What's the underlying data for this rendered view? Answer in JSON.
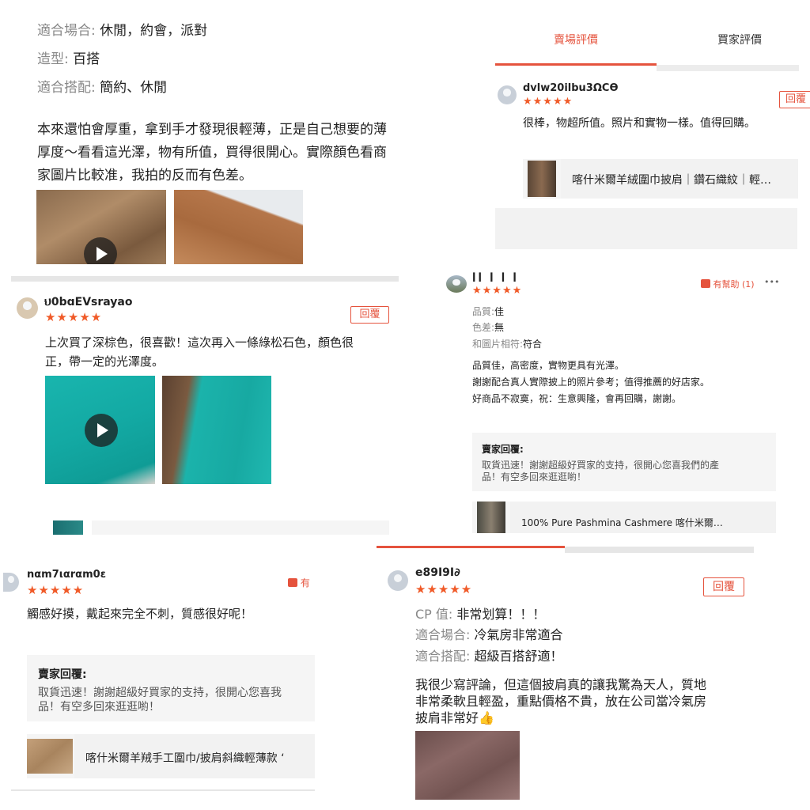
{
  "panel1": {
    "attr_occasion_label": "適合場合:",
    "attr_occasion_value": "休閒，約會，派對",
    "attr_style_label": "造型:",
    "attr_style_value": "百搭",
    "attr_match_label": "適合搭配:",
    "attr_match_value": "簡約、休閒",
    "review_line1": "本來還怕會厚重，拿到手才發現很輕薄，正是自己想要的薄",
    "review_line2": "厚度～看看這光澤，物有所值，買得很開心。實際顏色看商",
    "review_line3": "家圖片比較准，我拍的反而有色差。"
  },
  "panel2": {
    "tab_store": "賣場評價",
    "tab_buyer": "買家評價",
    "username": "dvlw20ilbu3ΩCϴ",
    "stars": "★★★★★",
    "reply": "回覆",
    "review": "很棒，物超所值。照片和實物一樣。值得回購。",
    "product": "喀什米爾羊絨圍巾披肩｜鑽石織紋｜輕…"
  },
  "panel3": {
    "username": "ህ0bɑEVsrayao",
    "stars": "★★★★★",
    "reply": "回覆",
    "review_line1": "上次買了深棕色，很喜歡！這次再入一條綠松石色，顏色很",
    "review_line2": "正，帶一定的光澤度。"
  },
  "panel4": {
    "username": "ꟾꟾ ꟾ ꟾ ꟾ",
    "stars": "★★★★★",
    "helpful": "有幫助 (1)",
    "more": "•••",
    "quality_label": "品質:",
    "quality_value": "佳",
    "color_label": "色差:",
    "color_value": "無",
    "match_label": "和圖片相符:",
    "match_value": "符合",
    "review_line1": "品質佳，高密度，實物更具有光澤。",
    "review_line2": "謝謝配合真人實際披上的照片參考；值得推薦的好店家。",
    "review_line3": "好商品不寂寞，祝：生意興隆，會再回購，謝謝。",
    "seller_title": "賣家回覆:",
    "seller_line1": "取貨迅速！謝謝超級好買家的支持，很開心您喜我們的產",
    "seller_line2": "品！有空多回來逛逛喲！",
    "product": "100%  Pure Pashmina  Cashmere  喀什米爾…"
  },
  "panel5": {
    "username": "nαm7ιαrαm0ε​",
    "stars": "★★★★★",
    "helpful": "有",
    "review": "觸感好摸，戴起來完全不刺，質感很好呢！",
    "seller_title": "賣家回覆:",
    "seller_line1": "取貨迅速！謝謝超級好買家的支持，很開心您喜我",
    "seller_line2": "品！有空多回來逛逛喲！",
    "product": "喀什米爾羊羢手工圍巾/披肩斜織輕薄款 ‘"
  },
  "panel6": {
    "username": "e89I9I∂",
    "stars": "★★★★★",
    "reply": "回覆",
    "cp_label": "CP 值:",
    "cp_value": "非常划算！！！",
    "occasion_label": "適合場合:",
    "occasion_value": "冷氣房非常適合",
    "match_label": "適合搭配:",
    "match_value": "超級百搭舒適！",
    "review_line1": "我很少寫評論，但這個披肩真的讓我驚為天人，質地",
    "review_line2": "非常柔軟且輕盈，重點價格不貴，放在公司當冷氣房",
    "review_line3": "披肩非常好👍"
  },
  "colors": {
    "accent": "#e5533d",
    "star": "#f05a28",
    "muted": "#888888"
  }
}
